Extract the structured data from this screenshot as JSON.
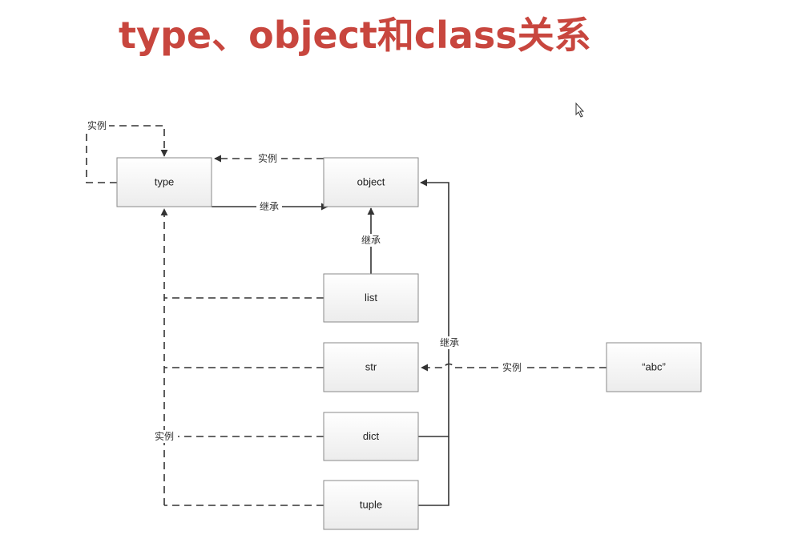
{
  "title": {
    "text": "type、object和class关系",
    "color": "#c8463e"
  },
  "diagram": {
    "nodes": [
      {
        "id": "type",
        "label": "type"
      },
      {
        "id": "object",
        "label": "object"
      },
      {
        "id": "list",
        "label": "list"
      },
      {
        "id": "str",
        "label": "str"
      },
      {
        "id": "dict",
        "label": "dict"
      },
      {
        "id": "tuple",
        "label": "tuple"
      },
      {
        "id": "abc",
        "label": "“abc”"
      }
    ],
    "edge_labels": {
      "type_self_instance": "实例",
      "object_to_type_instance": "实例",
      "type_to_object_inherit": "继承",
      "list_to_object_inherit": "继承",
      "right_inherit": "继承",
      "abc_to_str_instance": "实例",
      "builtins_to_type_instance": "实例"
    },
    "colors": {
      "node_fill_top": "#ffffff",
      "node_fill_bottom": "#ececec",
      "node_border": "#8a8a8a",
      "line": "#333333"
    }
  }
}
